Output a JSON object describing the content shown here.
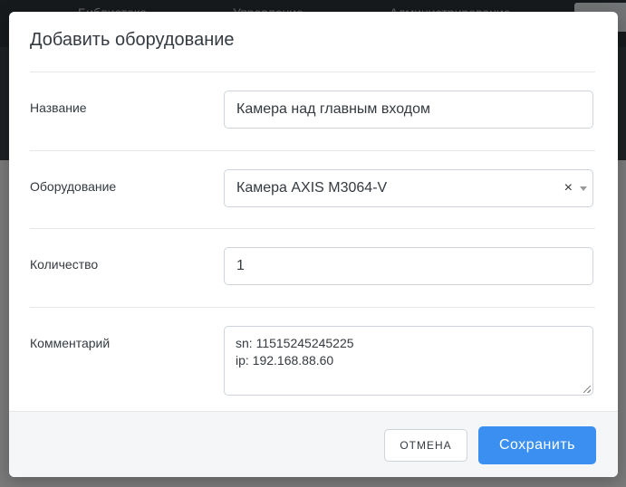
{
  "background": {
    "nav_items": [
      "Библиотека",
      "Управление",
      "Администрирование"
    ]
  },
  "modal": {
    "title": "Добавить оборудование",
    "fields": {
      "name": {
        "label": "Название",
        "value": "Камера над главным входом"
      },
      "equipment": {
        "label": "Оборудование",
        "value": "Камера AXIS M3064-V",
        "clear_symbol": "×"
      },
      "quantity": {
        "label": "Количество",
        "value": "1"
      },
      "comment": {
        "label": "Комментарий",
        "lines": [
          "sn: 11515245245225",
          "ip: 192.168.88.60"
        ]
      }
    },
    "footer": {
      "cancel_label": "ОТМЕНА",
      "save_label": "Сохранить"
    }
  },
  "colors": {
    "primary": "#3b8ff0",
    "overlay": "rgba(0,0,0,0.5)"
  }
}
